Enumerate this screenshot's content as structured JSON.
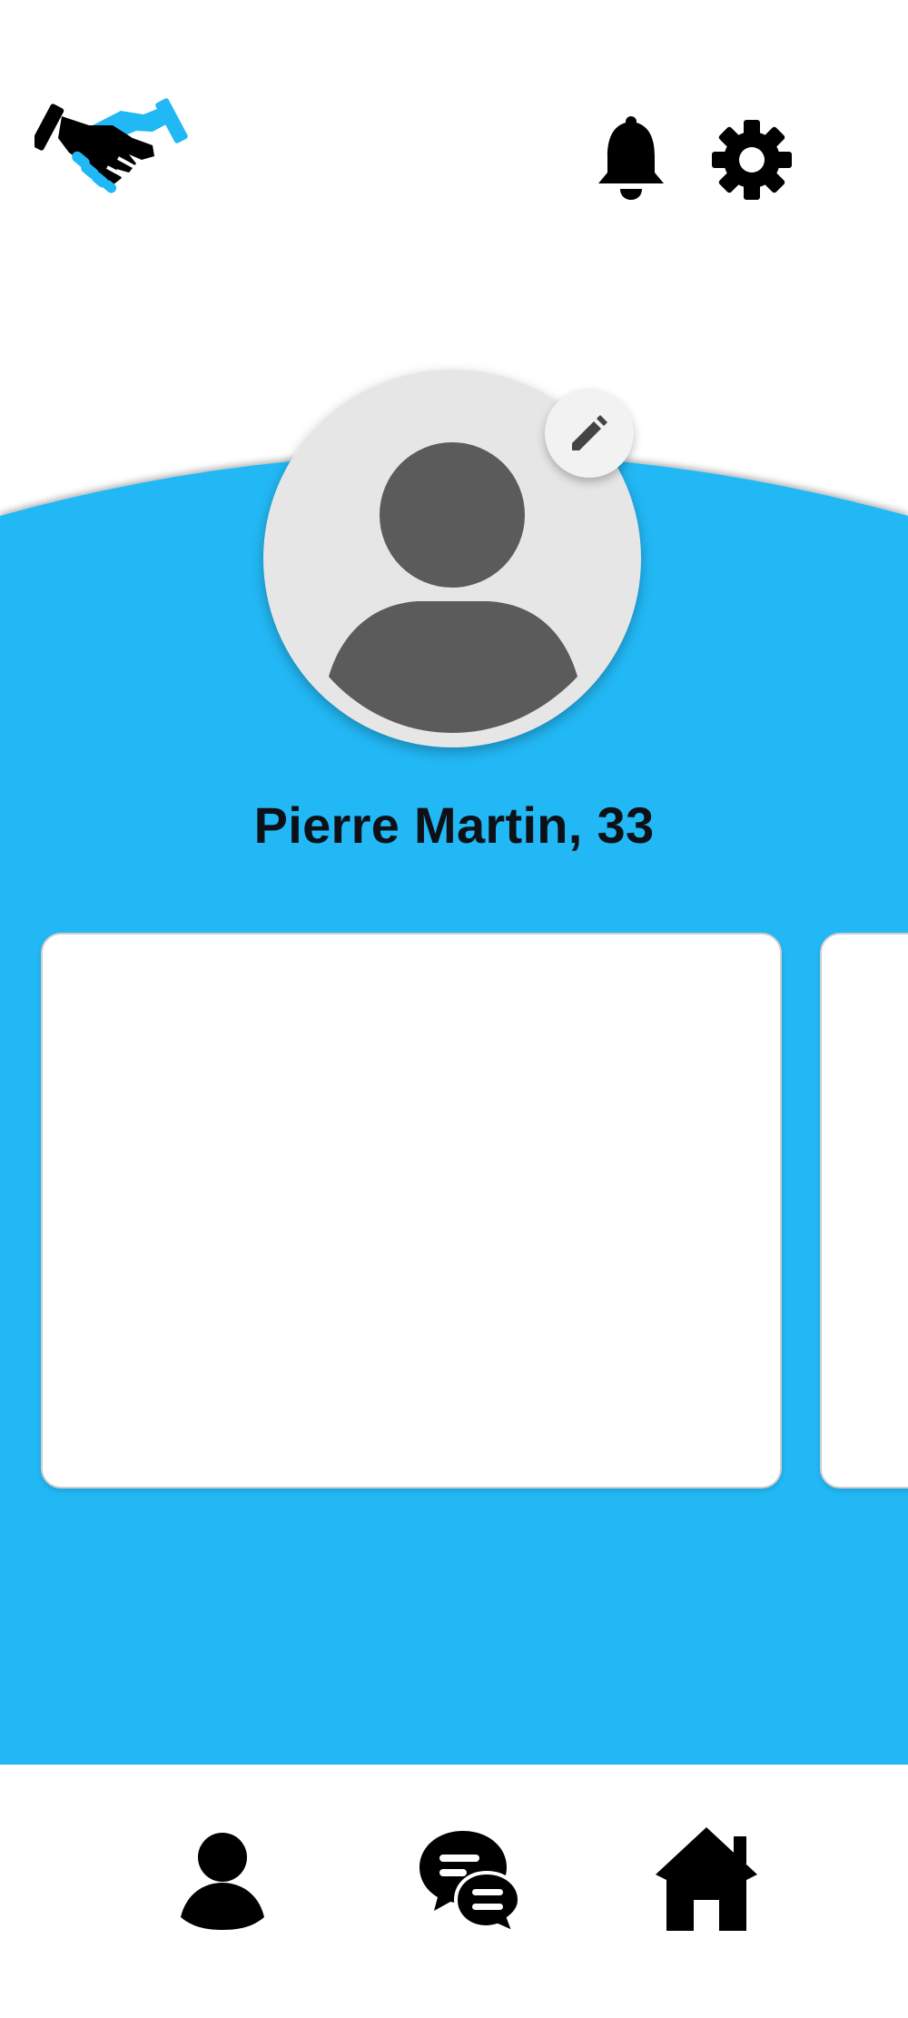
{
  "profile": {
    "name_age": "Pierre Martin, 33"
  },
  "icons": {
    "logo": "handshake-logo",
    "notifications": "bell-icon",
    "settings": "gear-icon",
    "edit": "pencil-icon",
    "avatar": "person-placeholder-icon",
    "nav_profile": "person-icon",
    "nav_chat": "chat-bubbles-icon",
    "nav_home": "home-icon"
  },
  "colors": {
    "accent": "#20b8f5",
    "icon_dark": "#000000",
    "avatar_bg": "#e6e6e6",
    "avatar_figure": "#5b5b5b"
  }
}
